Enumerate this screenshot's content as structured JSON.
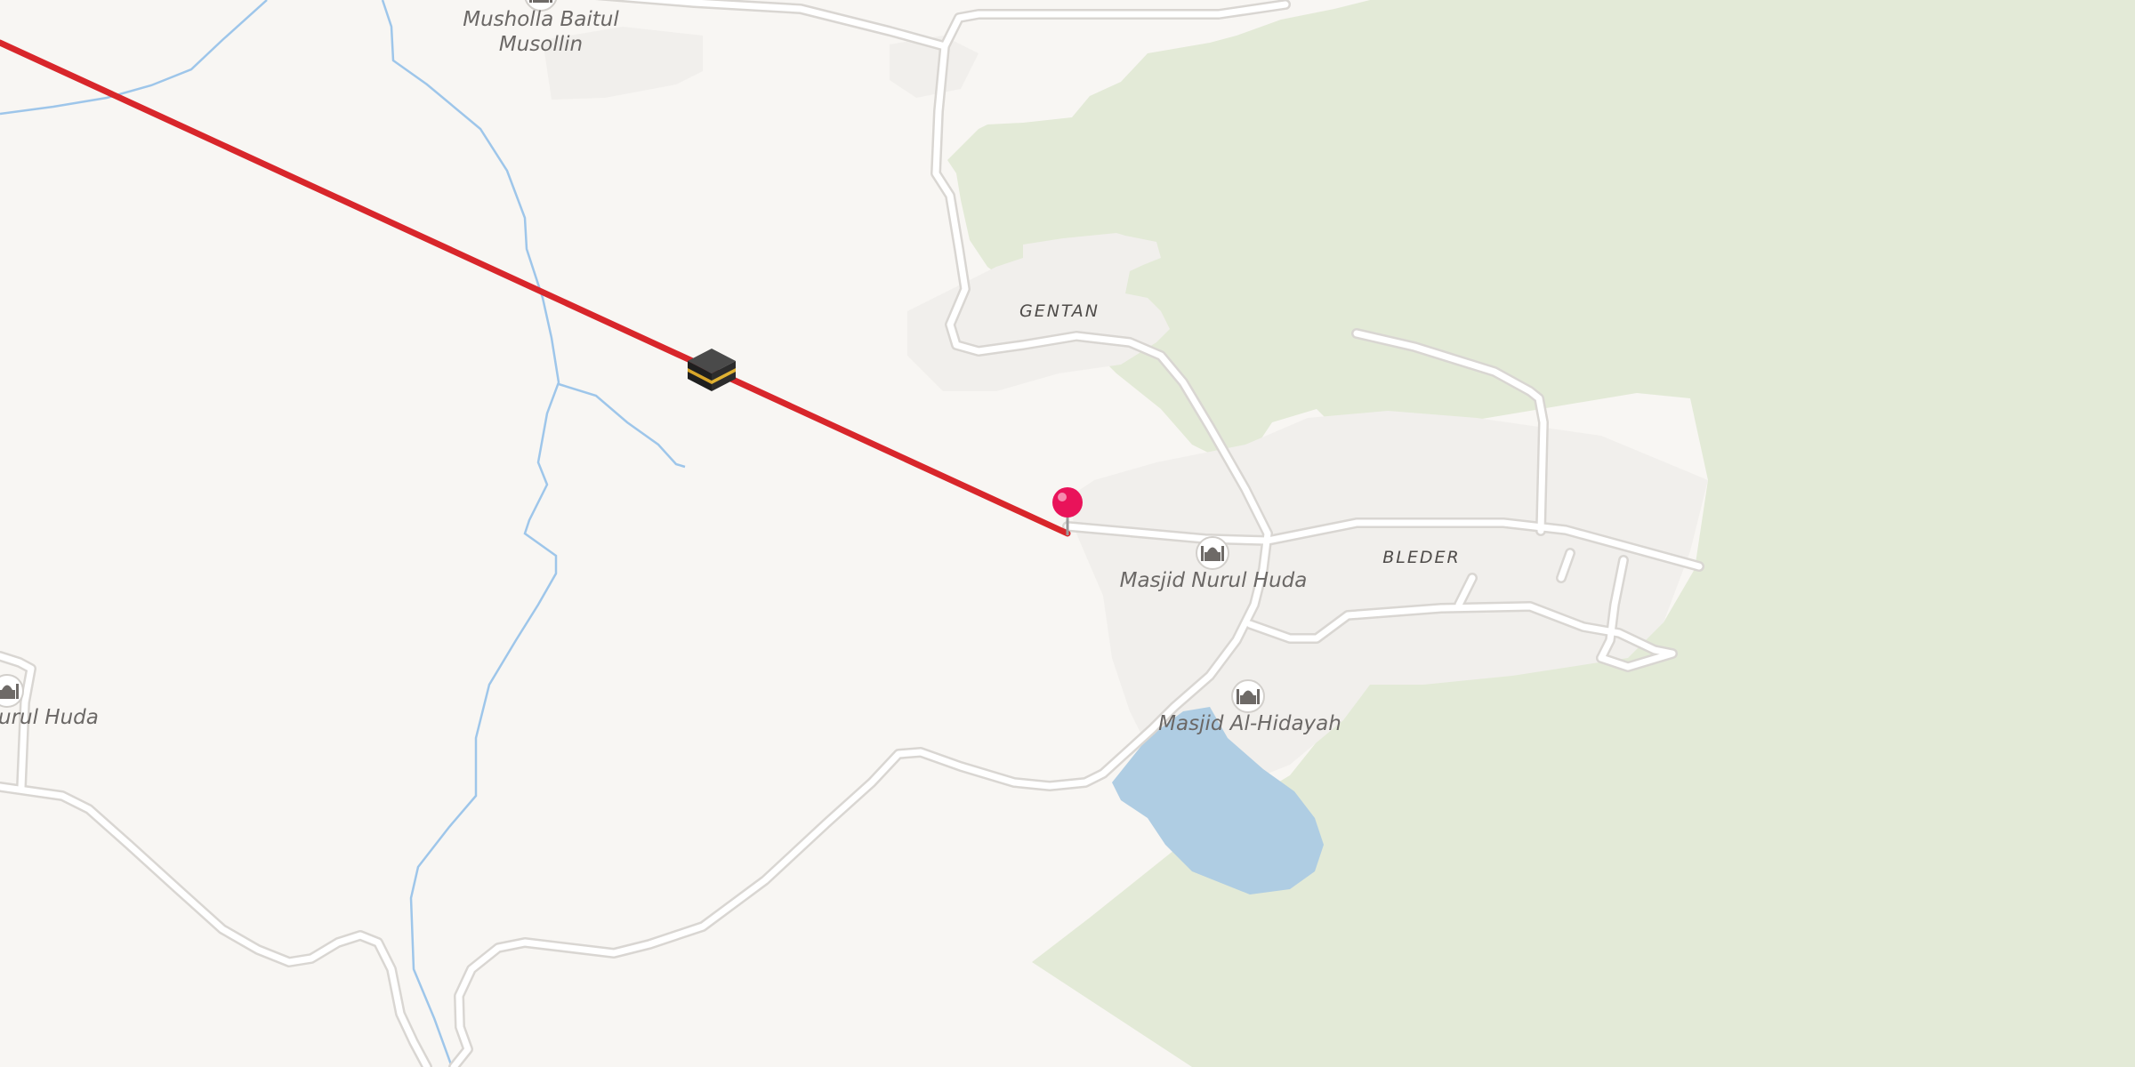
{
  "map": {
    "colors": {
      "land": "#f8f6f3",
      "forest": "#e3ead7",
      "water": "#afcde3",
      "road_fill": "#ffffff",
      "road_casing": "#d9d6d2",
      "residential": "#f1efec",
      "stream": "#9ec6ea",
      "qibla_line": "#d8262b",
      "pin": "#e9135a"
    },
    "place_labels": {
      "gentan": "GENTAN",
      "bleder": "BLEDER"
    },
    "poi_labels": {
      "musholla_line1": "Musholla Baitul",
      "musholla_line2": "Musollin",
      "nurul_huda_main": "Masjid Nurul Huda",
      "nurul_huda_left": "urul Huda",
      "al_hidayah": "Masjid Al-Hidayah"
    },
    "icons": {
      "mosque": "mosque-icon",
      "kaaba": "kaaba-icon",
      "pin": "location-pin-icon"
    }
  }
}
